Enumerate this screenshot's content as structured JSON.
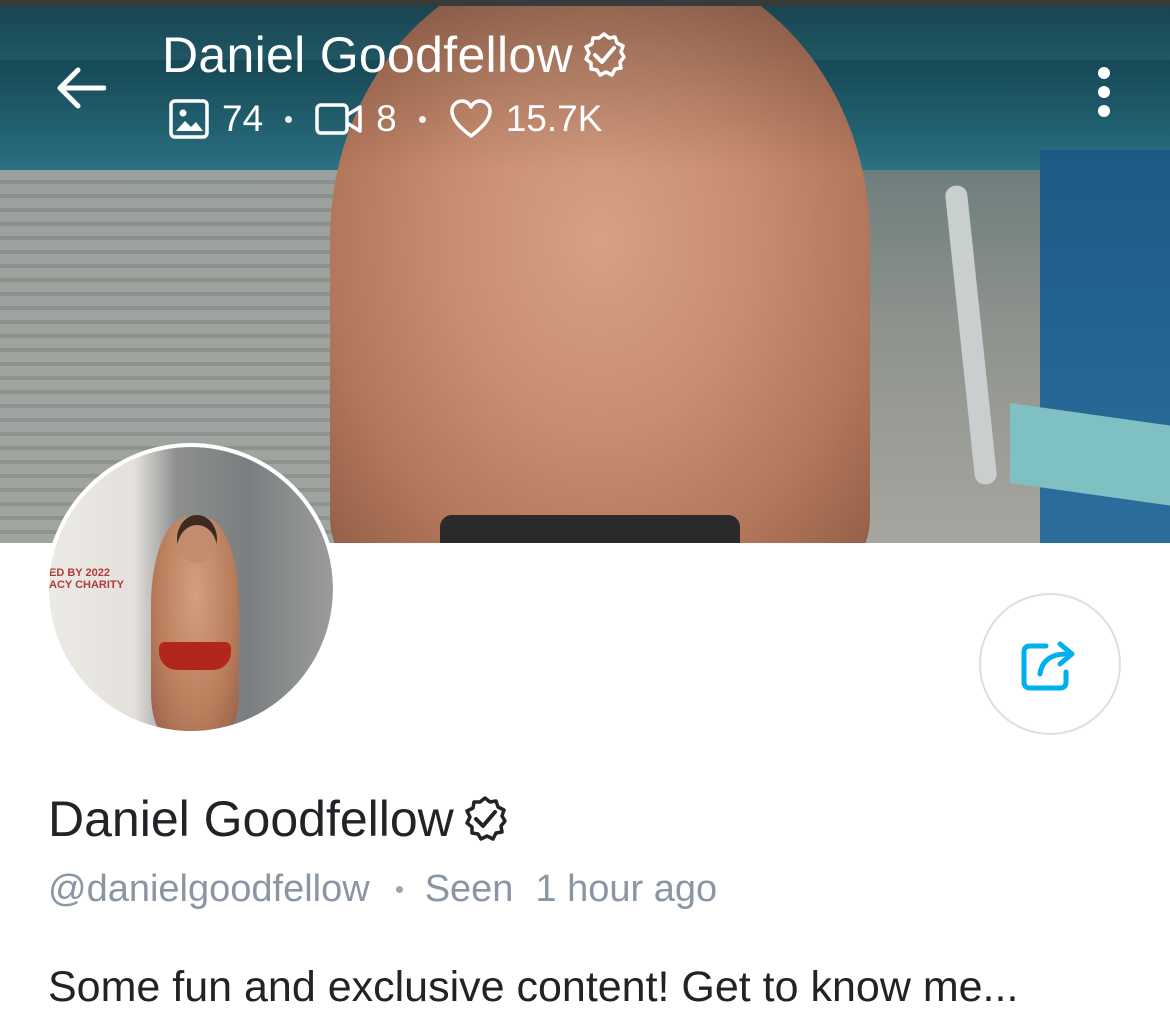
{
  "header": {
    "title": "Daniel Goodfellow",
    "stats": {
      "photos": "74",
      "videos": "8",
      "likes": "15.7K"
    }
  },
  "profile": {
    "name": "Daniel Goodfellow",
    "username": "@danielgoodfellow",
    "seen_label": "Seen",
    "seen_time": "1 hour ago",
    "bio": "Some fun and exclusive content! Get to know me..."
  },
  "avatar": {
    "sign_text": "ED BY 2022\nACY CHARITY"
  },
  "icons": {
    "back": "arrow-left-icon",
    "verified": "verified-badge-icon",
    "photos": "image-icon",
    "videos": "video-camera-icon",
    "likes": "heart-icon",
    "more": "more-vertical-icon",
    "share": "share-icon"
  },
  "colors": {
    "accent": "#00aff0",
    "text_primary": "#222326",
    "text_secondary": "#8a96a3"
  }
}
